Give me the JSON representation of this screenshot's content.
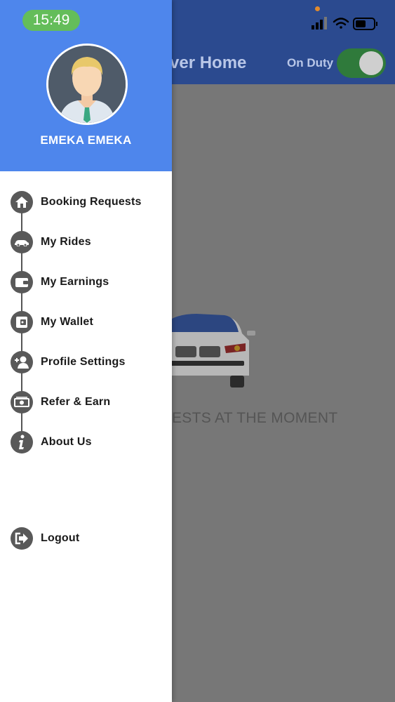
{
  "status_bar": {
    "time": "15:49"
  },
  "background": {
    "title": "ver Home",
    "duty_label": "On Duty",
    "duty_on": true,
    "empty_message": "ESTS AT THE MOMENT"
  },
  "drawer": {
    "user_name": "EMEKA EMEKA",
    "menu": [
      {
        "label": "Booking Requests",
        "icon": "home-icon"
      },
      {
        "label": "My Rides",
        "icon": "car-icon"
      },
      {
        "label": "My Earnings",
        "icon": "wallet-icon"
      },
      {
        "label": "My Wallet",
        "icon": "wallet-card-icon"
      },
      {
        "label": "Profile Settings",
        "icon": "user-add-icon"
      },
      {
        "label": "Refer & Earn",
        "icon": "money-icon"
      },
      {
        "label": "About Us",
        "icon": "info-icon"
      }
    ],
    "logout": {
      "label": "Logout",
      "icon": "logout-icon"
    }
  },
  "colors": {
    "drawer_header": "#4e86ec",
    "app_header": "#2b4a8f",
    "time_pill": "#64bd5a",
    "icon_bg": "#595959"
  }
}
